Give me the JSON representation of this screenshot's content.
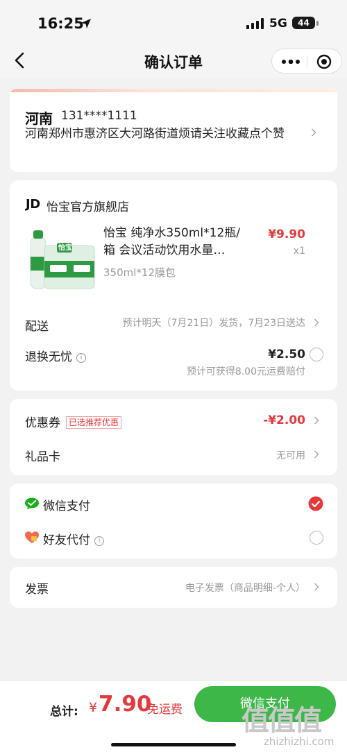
{
  "status_bar": {
    "time": "16:25",
    "network": "5G",
    "battery": "44",
    "icons": [
      "location-arrow-icon",
      "signal-icon"
    ]
  },
  "nav": {
    "title": "确认订单",
    "icons": [
      "back-icon",
      "more-icon",
      "target-icon"
    ]
  },
  "address": {
    "name": "河南",
    "phone": "131****1111",
    "detail": "河南郑州市惠济区大河路街道烦请关注收藏点个赞"
  },
  "store": {
    "logo": "JD",
    "name": "怡宝官方旗舰店",
    "product": {
      "title": "怡宝 纯净水350ml*12瓶/箱 会议活动饮用水量…",
      "price": "¥9.90",
      "quantity": "x1",
      "spec": "350ml*12膜包"
    },
    "delivery": {
      "label": "配送",
      "value": "预计明天（7月21日）发货，7月23日送达"
    },
    "return": {
      "label": "退换无忧",
      "price": "¥2.50",
      "note": "预计可获得8.00元运费赔付",
      "selected": false
    }
  },
  "coupon": {
    "label": "优惠券",
    "tag": "已选推荐优惠",
    "value": "-¥2.00"
  },
  "gift_card": {
    "label": "礼品卡",
    "value": "无可用"
  },
  "payment": {
    "wechat": {
      "label": "微信支付",
      "selected": true,
      "icon": "wechat-pay-icon"
    },
    "friend": {
      "label": "好友代付",
      "selected": false,
      "icon": "friend-pay-icon"
    }
  },
  "invoice": {
    "label": "发票",
    "value": "电子发票（商品明细-个人）"
  },
  "bottom": {
    "total_label": "总计:",
    "currency": "¥",
    "amount": "7.90",
    "free_shipping": "免运费",
    "pay_button": "微信支付"
  },
  "watermark": {
    "logo": "值值值",
    "text": "zhizhizhi.com"
  },
  "colors": {
    "accent_red": "#e4393c",
    "wechat_green": "#3eb749"
  }
}
